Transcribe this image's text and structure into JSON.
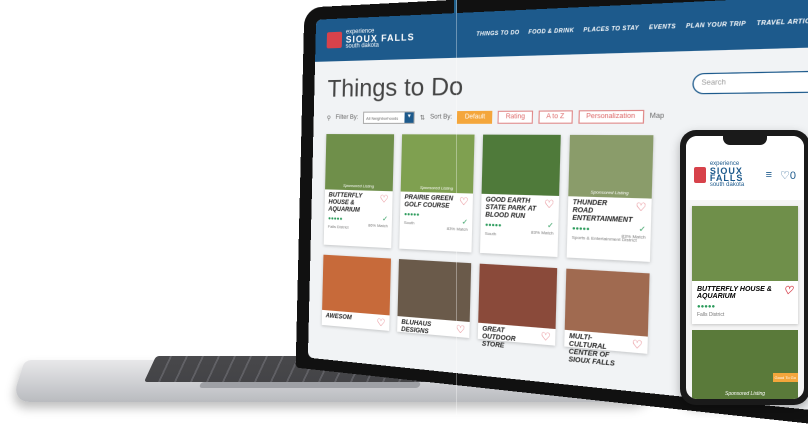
{
  "nav": {
    "logo_top": "experience",
    "logo_main": "SIOUX FALLS",
    "logo_sub": "south dakota",
    "links": [
      "THINGS TO DO",
      "FOOD & DRINK",
      "PLACES TO STAY",
      "EVENTS",
      "PLAN YOUR TRIP",
      "TRAVEL ARTICLES"
    ],
    "favorites_count": "0"
  },
  "page": {
    "title": "Things to Do",
    "search_placeholder": "Search"
  },
  "filters": {
    "filter_by_label": "Filter By:",
    "filter_select": "All Neighborhoods",
    "sort_by_label": "Sort By:",
    "sort_options": [
      "Default",
      "Rating",
      "A to Z",
      "Personalization"
    ],
    "map_toggle": "Map"
  },
  "cards_row1": [
    {
      "name": "BUTTERFLY HOUSE & AQUARIUM",
      "rating": "●●●●●",
      "location": "Falls District",
      "pct": "86% Match",
      "sponsored": "Sponsored Listing",
      "color": "#6f8f4a"
    },
    {
      "name": "PRAIRIE GREEN GOLF COURSE",
      "rating": "●●●●●",
      "location": "South",
      "pct": "83% Match",
      "sponsored": "Sponsored Listing",
      "color": "#7fa050"
    },
    {
      "name": "GOOD EARTH STATE PARK AT BLOOD RUN",
      "rating": "●●●●●",
      "location": "South",
      "pct": "83% Match",
      "sponsored": "",
      "color": "#4f7a3a"
    },
    {
      "name": "THUNDER ROAD ENTERTAINMENT",
      "rating": "●●●●●",
      "location": "Sports & Entertainment District",
      "pct": "83% Match",
      "sponsored": "Sponsored Listing",
      "color": "#8a9c6a"
    }
  ],
  "cards_row2": [
    {
      "name": "AWESOM",
      "color": "#c76a3a"
    },
    {
      "name": "BLUHAUS DESIGNS",
      "color": "#6a5a4a"
    },
    {
      "name": "GREAT OUTDOOR STORE",
      "color": "#8a4a3a"
    },
    {
      "name": "MULTI-CULTURAL CENTER OF SIOUX FALLS",
      "color": "#a06a50"
    }
  ],
  "phone": {
    "favorites_count": "0",
    "card_name": "BUTTERFLY HOUSE & AQUARIUM",
    "card_rating": "●●●●●",
    "card_location": "Falls District",
    "sponsored": "Sponsored Listing",
    "badge": "Good To Go"
  }
}
